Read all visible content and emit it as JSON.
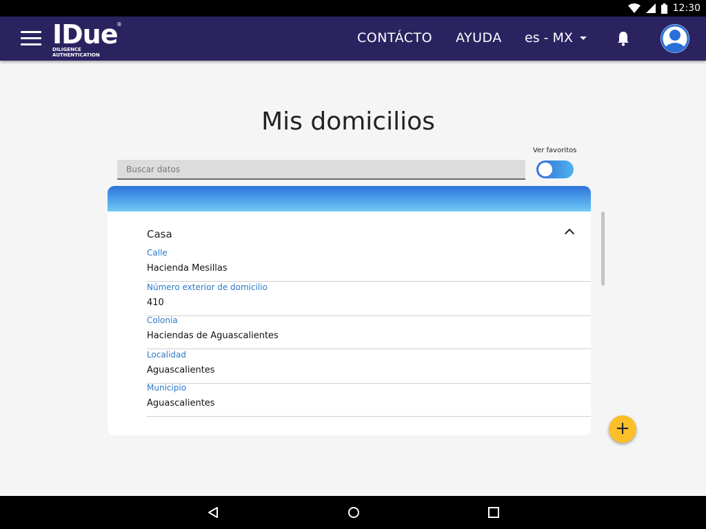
{
  "status_bar": {
    "time": "12:30",
    "icons": [
      "wifi-icon",
      "cell-signal-icon",
      "battery-icon"
    ]
  },
  "app_bar": {
    "logo_text": "IDue",
    "logo_registered": "®",
    "logo_tagline": "DILIGENCE AUTHENTICATION",
    "nav": {
      "contacto": "CONTÁCTO",
      "ayuda": "AYUDA"
    },
    "language": "es - MX",
    "icons": [
      "menu-icon",
      "bell-icon",
      "avatar-icon"
    ],
    "colors": {
      "background": "#2a2360"
    }
  },
  "page": {
    "title": "Mis domicilios",
    "search": {
      "placeholder": "Buscar datos",
      "value": ""
    },
    "favorites": {
      "label": "Ver favoritos",
      "enabled": false
    }
  },
  "card": {
    "section_title": "Casa",
    "expanded": true,
    "fields": [
      {
        "label": "Calle",
        "value": "Hacienda Mesillas"
      },
      {
        "label": "Número exterior de domicilio",
        "value": "410"
      },
      {
        "label": "Colonia",
        "value": "Haciendas de Aguascalientes"
      },
      {
        "label": "Localidad",
        "value": "Aguascalientes"
      },
      {
        "label": "Municipio",
        "value": "Aguascalientes"
      }
    ],
    "colors": {
      "label": "#2a78c8",
      "header_gradient_start": "#2d73dc",
      "header_gradient_end": "#73c9f4"
    }
  },
  "fab": {
    "symbol": "+",
    "color": "#fbbf2a"
  },
  "system_nav": {
    "buttons": [
      "back-icon",
      "home-icon",
      "recents-icon"
    ]
  }
}
